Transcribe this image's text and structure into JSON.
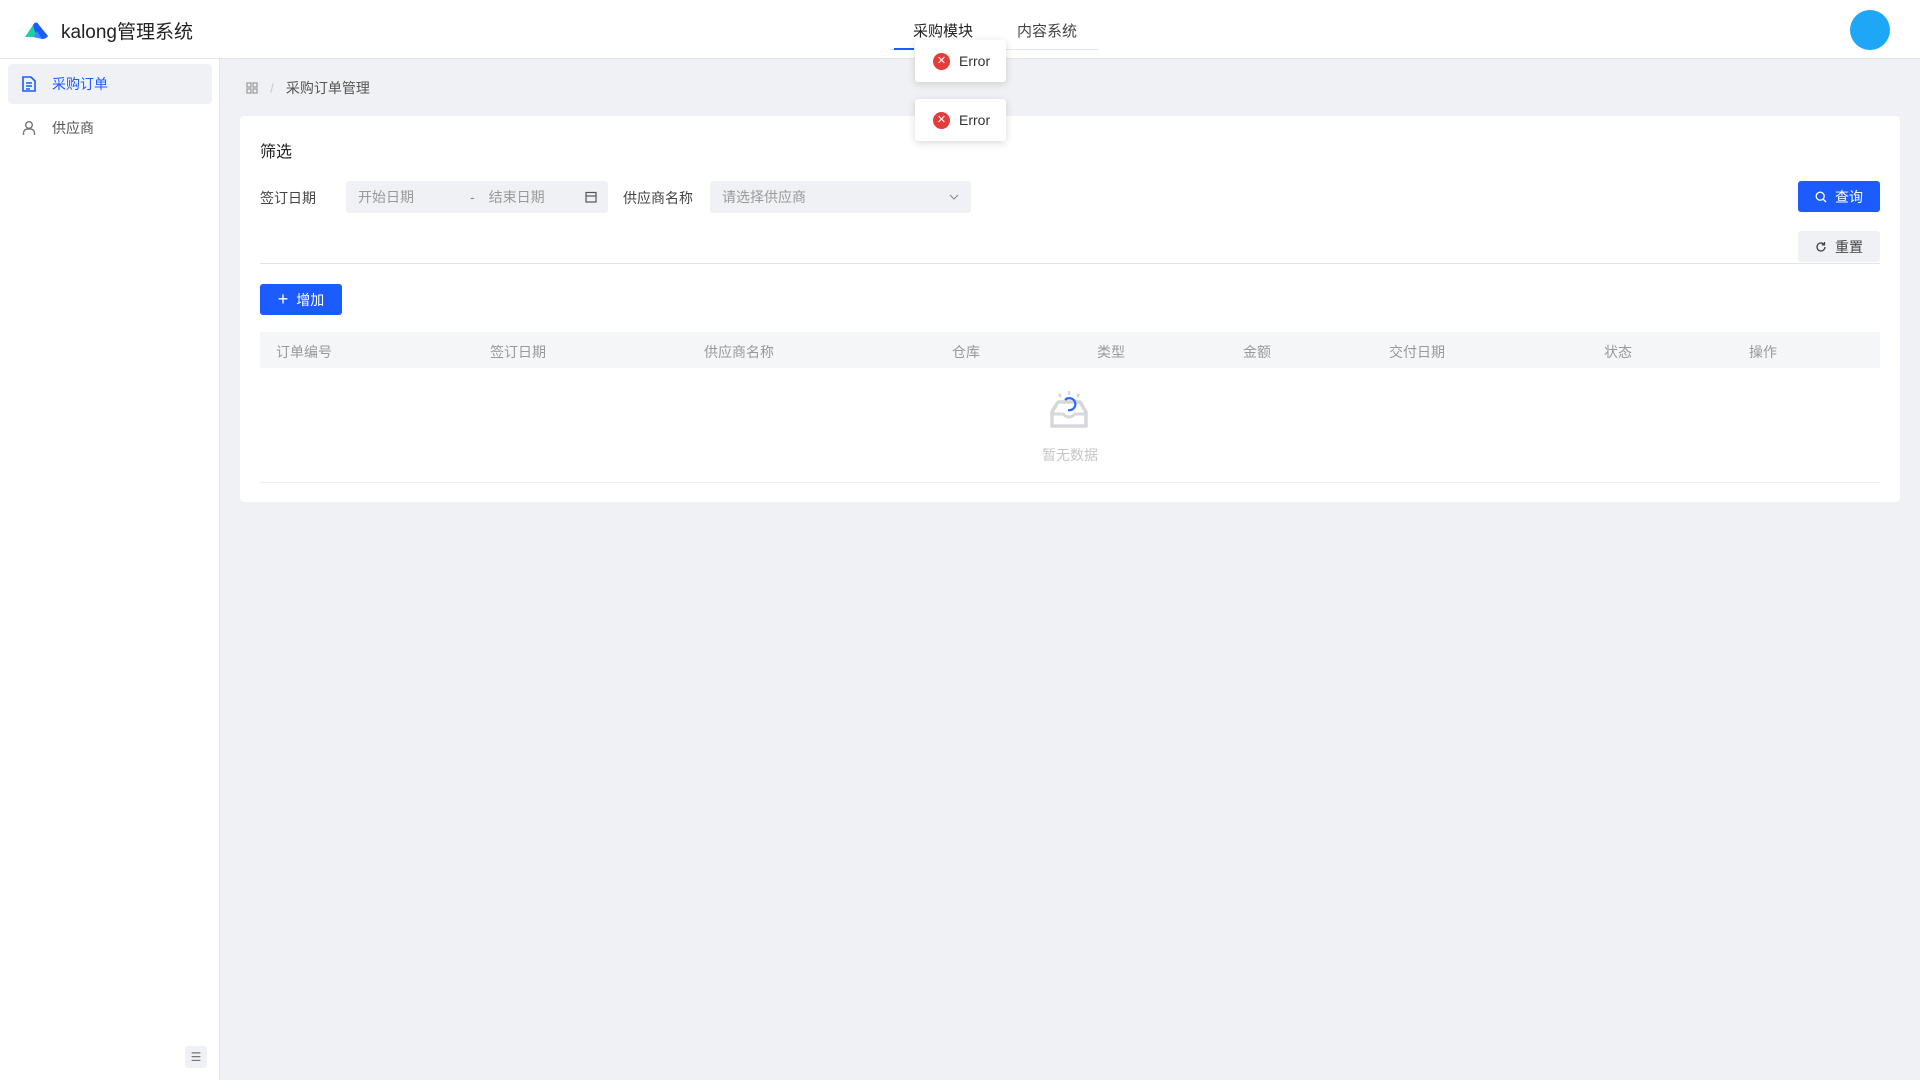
{
  "app": {
    "title": "kalong管理系统"
  },
  "header": {
    "tabs": [
      {
        "label": "采购模块",
        "active": true
      },
      {
        "label": "内容系统",
        "active": false
      }
    ]
  },
  "sidebar": {
    "items": [
      {
        "label": "采购订单",
        "icon": "file-text-icon",
        "active": true
      },
      {
        "label": "供应商",
        "icon": "user-icon",
        "active": false
      }
    ]
  },
  "breadcrumb": {
    "current": "采购订单管理"
  },
  "filter": {
    "title": "筛选",
    "date_label": "签订日期",
    "start_placeholder": "开始日期",
    "separator": "-",
    "end_placeholder": "结束日期",
    "supplier_label": "供应商名称",
    "supplier_placeholder": "请选择供应商",
    "query_label": "查询",
    "reset_label": "重置"
  },
  "toolbar": {
    "add_label": "增加"
  },
  "table": {
    "columns": [
      "订单编号",
      "签订日期",
      "供应商名称",
      "仓库",
      "类型",
      "金额",
      "交付日期",
      "状态",
      "操作"
    ],
    "empty_text": "暂无数据"
  },
  "toasts": [
    {
      "text": "Error"
    },
    {
      "text": "Error"
    }
  ],
  "colors": {
    "accent": "#1c5cff",
    "error": "#e63b3b",
    "avatar": "#1ea7f7"
  }
}
